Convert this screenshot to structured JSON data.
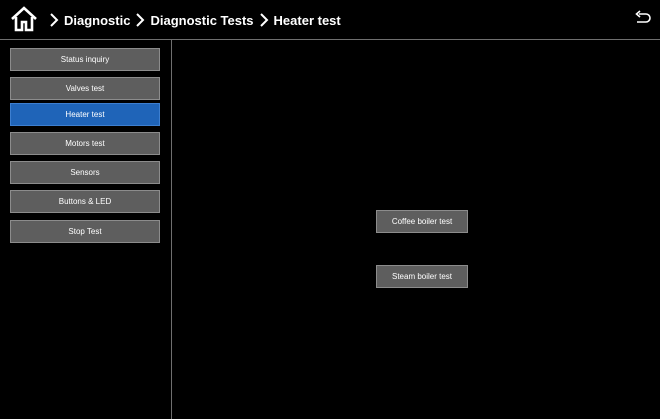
{
  "header": {
    "breadcrumbs": [
      "Diagnostic",
      "Diagnostic Tests",
      "Heater test"
    ],
    "home_icon": "home-icon",
    "back_icon": "back-arrow-icon"
  },
  "sidebar": {
    "items": [
      {
        "label": "Status inquiry",
        "active": false
      },
      {
        "label": "Valves test",
        "active": false
      },
      {
        "label": "Heater test",
        "active": true
      },
      {
        "label": "Motors test",
        "active": false
      },
      {
        "label": "Sensors",
        "active": false
      },
      {
        "label": "Buttons & LED",
        "active": false
      },
      {
        "label": "Stop Test",
        "active": false
      }
    ]
  },
  "main": {
    "coffee_boiler_label": "Coffee boiler test",
    "steam_boiler_label": "Steam boiler test"
  },
  "colors": {
    "background": "#000000",
    "button": "#5e5e5e",
    "active": "#1f64b8"
  }
}
